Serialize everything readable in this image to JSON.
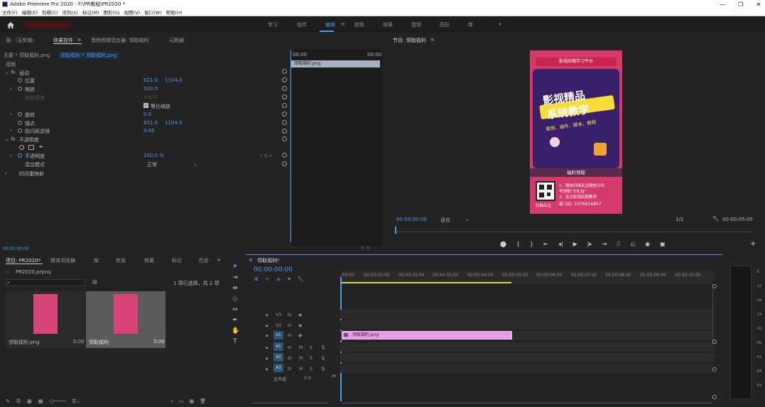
{
  "window": {
    "title": "Adobe Premiere Pro 2020 - F:\\PR教程\\PR2020 *",
    "controls": [
      "—",
      "❐",
      "✕"
    ]
  },
  "menu": [
    "文件(F)",
    "编辑(E)",
    "剪辑(C)",
    "序列(S)",
    "标记(M)",
    "图形(G)",
    "视图(V)",
    "窗口(W)",
    "帮助(H)"
  ],
  "workspaces": {
    "items": [
      "学习",
      "组件",
      "编辑",
      "颜色",
      "效果",
      "音频",
      "图形",
      "库"
    ],
    "active": "编辑",
    "more": "»"
  },
  "source_panel": {
    "tabs": [
      "源:（无剪辑）",
      "效果控件",
      "音频剪辑混合器: 领取福利",
      "元数据"
    ],
    "active_tab": "效果控件",
    "clip_path_main": "主要 * 领取福利.png",
    "clip_path_seq": "领取福利 * 领取福利.png",
    "section_video": "视频",
    "mini_time_start": "00:00",
    "mini_time_end": "00:00",
    "mini_clip": "领取福利.png",
    "motion": {
      "label": "运动",
      "position_label": "位置",
      "position_x": "621.0",
      "position_y": "1104.0",
      "scale_label": "缩放",
      "scale_value": "100.0",
      "scale_width_label": "缩放宽度",
      "scale_width_value": "100.0",
      "uniform_label": "等比缩放",
      "rotation_label": "旋转",
      "rotation_value": "0.0",
      "anchor_label": "锚点",
      "anchor_x": "621.0",
      "anchor_y": "1104.0",
      "flicker_label": "防闪烁滤镜",
      "flicker_value": "0.00"
    },
    "opacity": {
      "label": "不透明度",
      "value_label": "不透明度",
      "value": "100.0 %",
      "blend_label": "混合模式",
      "blend_value": "正常"
    },
    "time_remap": "时间重映射",
    "timecode": "00:00:00:00"
  },
  "program_panel": {
    "title": "节目: 领取福利",
    "timecode": "00:00:00:00",
    "fit": "适合",
    "resolution": "1/2",
    "duration": "00:00:05:00",
    "poster": {
      "banner": "影视后期学习平台",
      "headline1": "影视精品",
      "headline2": "系统教学",
      "subline": "案例、插件、脚本、教程",
      "button": "福利领取",
      "info1": "1、微信扫描关注微信公众",
      "info2": "号领取\"大礼包\"",
      "info3": "2、关注影视后期教学",
      "qq": "或 QQ: 1076914857",
      "scan": "扫描关注"
    }
  },
  "project_panel": {
    "tabs": [
      "项目: PR2020",
      "媒体浏览器",
      "库",
      "信息",
      "效果",
      "标记",
      "历史"
    ],
    "active_tab": "项目: PR2020",
    "more": "»",
    "file": "PR2020.prproj",
    "selection": "1 项已选择，共 2 项",
    "items": [
      {
        "name": "领取福利.png",
        "duration": "5:00"
      },
      {
        "name": "领取福利",
        "duration": "5:00"
      }
    ]
  },
  "timeline": {
    "tab": "领取福利",
    "timecode": "00:00:00:00",
    "ruler": [
      ":00:00",
      "00:00:01:00",
      "00:00:02:00",
      "00:00:03:00",
      "00:00:04:00",
      "00:00:05:00",
      "00:00:06:00",
      "00:00:07:00",
      "00:00:08:00",
      "00:00:09:00",
      "00:00:10:00"
    ],
    "video_tracks": [
      "V3",
      "V2",
      "V1"
    ],
    "audio_tracks": [
      "A1",
      "A2",
      "A3"
    ],
    "track_toggles": [
      "M",
      "S"
    ],
    "master": "主声道",
    "master_value": "0.0",
    "clip": "领取福利.png",
    "active_track": "V1"
  },
  "meter": {
    "labels": [
      "-6",
      "-12",
      "-18",
      "-24",
      "-30",
      "-36",
      "-42",
      "-48",
      "-54"
    ]
  },
  "colors": {
    "accent": "#4e9ce8",
    "clip": "#e59be6",
    "poster": "#d63a6d"
  }
}
